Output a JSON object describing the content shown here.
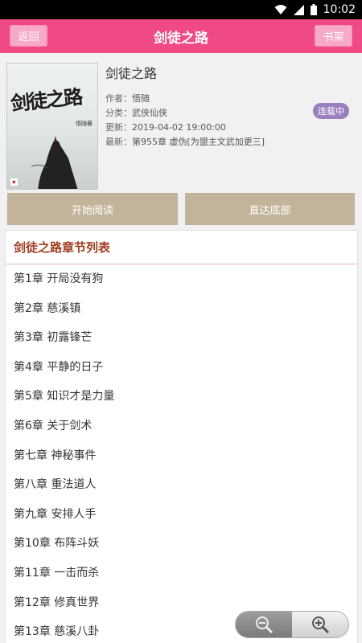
{
  "status": {
    "time": "10:02"
  },
  "topbar": {
    "back_label": "返回",
    "title": "剑徒之路",
    "shelf_label": "书架"
  },
  "book": {
    "cover_title": "剑徒之路",
    "cover_author": "悟随著",
    "name": "剑徒之路",
    "author_label": "作者：",
    "author": "悟随",
    "category_label": "分类：",
    "category": "武侠仙侠",
    "updated_label": "更新：",
    "updated": "2019-04-02 19:00:00",
    "latest_label": "最新：",
    "latest": "第955章 虚伪[为盟主文武加更三]",
    "status_badge": "连载中"
  },
  "actions": {
    "start_label": "开始阅读",
    "bottom_label": "直达底部"
  },
  "chapters": {
    "title": "剑徒之路章节列表",
    "items": [
      "第1章 开局没有狗",
      "第2章 慈溪镇",
      "第3章 初露锋芒",
      "第4章 平静的日子",
      "第5章 知识才是力量",
      "第6章 关于剑术",
      "第七章 神秘事件",
      "第八章 重法道人",
      "第九章 安排人手",
      "第10章 布阵斗妖",
      "第11章 一击而杀",
      "第12章 修真世界",
      "第13章 慈溪八卦"
    ]
  },
  "colors": {
    "accent": "#ef4a85",
    "action": "#c2b49a",
    "badge": "#9b7fc1",
    "chapter_title": "#a23d20"
  }
}
